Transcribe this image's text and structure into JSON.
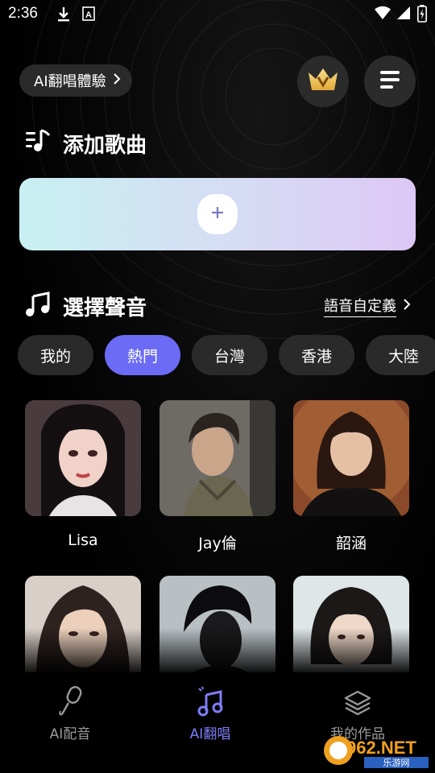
{
  "status_bar": {
    "time": "2:36"
  },
  "header": {
    "experience_label": "AI翻唱體驗",
    "vip_icon": "crown-icon",
    "menu_icon": "menu-icon"
  },
  "add_song": {
    "title": "添加歌曲",
    "add_icon": "plus-icon"
  },
  "select_voice": {
    "title": "選擇聲音",
    "custom_link": "語音自定義",
    "tabs": [
      {
        "label": "我的",
        "active": false
      },
      {
        "label": "熱門",
        "active": true
      },
      {
        "label": "台灣",
        "active": false
      },
      {
        "label": "香港",
        "active": false
      },
      {
        "label": "大陸",
        "active": false
      }
    ],
    "voices": [
      {
        "name": "Lisa"
      },
      {
        "name": "Jay倫"
      },
      {
        "name": "韶涵"
      },
      {
        "name": ""
      },
      {
        "name": ""
      },
      {
        "name": ""
      }
    ]
  },
  "bottom_nav": {
    "items": [
      {
        "label": "AI配音",
        "icon": "microphone-icon",
        "active": false
      },
      {
        "label": "AI翻唱",
        "icon": "music-note-icon",
        "active": true
      },
      {
        "label": "我的作品",
        "icon": "layers-icon",
        "active": false
      }
    ]
  },
  "watermark": {
    "brand": "962.NET",
    "sub": "乐游网"
  },
  "colors": {
    "accent": "#6b6bf5",
    "card_gradient_start": "#c8f0f2",
    "card_gradient_end": "#ddc8f5",
    "chip_bg": "#2a2a2a"
  }
}
